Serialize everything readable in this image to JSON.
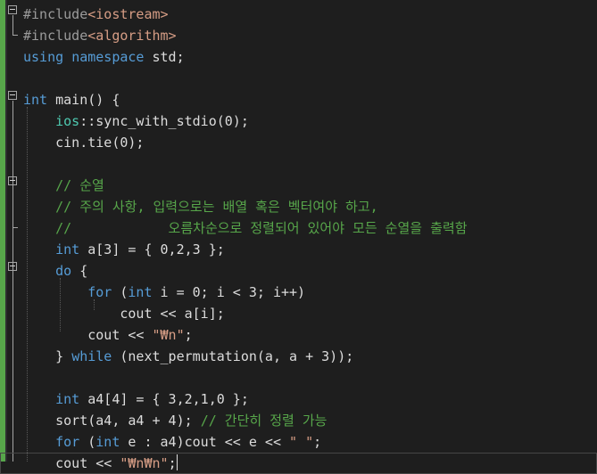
{
  "editor": {
    "lines": [
      {
        "tokens": [
          {
            "t": "#include",
            "c": "pp"
          },
          {
            "t": "<iostream>",
            "c": "inc"
          }
        ]
      },
      {
        "tokens": [
          {
            "t": "#include",
            "c": "pp"
          },
          {
            "t": "<algorithm>",
            "c": "inc"
          }
        ]
      },
      {
        "tokens": [
          {
            "t": "using",
            "c": "kw"
          },
          {
            "t": " "
          },
          {
            "t": "namespace",
            "c": "kw"
          },
          {
            "t": " std;"
          }
        ]
      },
      {
        "tokens": []
      },
      {
        "tokens": [
          {
            "t": "int",
            "c": "kw"
          },
          {
            "t": " main() {"
          }
        ]
      },
      {
        "tokens": [
          {
            "t": "    "
          },
          {
            "t": "ios",
            "c": "ns"
          },
          {
            "t": "::sync_with_stdio(0);"
          }
        ]
      },
      {
        "tokens": [
          {
            "t": "    cin.tie(0);"
          }
        ]
      },
      {
        "tokens": []
      },
      {
        "tokens": [
          {
            "t": "    "
          },
          {
            "t": "// 순열",
            "c": "cm"
          }
        ]
      },
      {
        "tokens": [
          {
            "t": "    "
          },
          {
            "t": "// 주의 사항, 입력으로는 배열 혹은 벡터여야 하고,",
            "c": "cm"
          }
        ]
      },
      {
        "tokens": [
          {
            "t": "    "
          },
          {
            "t": "//            오름차순으로 정렬되어 있어야 모든 순열을 출력함",
            "c": "cm"
          }
        ]
      },
      {
        "tokens": [
          {
            "t": "    "
          },
          {
            "t": "int",
            "c": "kw"
          },
          {
            "t": " a[3] = { 0,2,3 };"
          }
        ]
      },
      {
        "tokens": [
          {
            "t": "    "
          },
          {
            "t": "do",
            "c": "kw"
          },
          {
            "t": " {"
          }
        ]
      },
      {
        "tokens": [
          {
            "t": "        "
          },
          {
            "t": "for",
            "c": "kw"
          },
          {
            "t": " ("
          },
          {
            "t": "int",
            "c": "kw"
          },
          {
            "t": " i = 0; i < 3; i++)"
          }
        ]
      },
      {
        "tokens": [
          {
            "t": "            cout << a[i];"
          }
        ]
      },
      {
        "tokens": [
          {
            "t": "        cout << "
          },
          {
            "t": "\"₩n\"",
            "c": "str"
          },
          {
            "t": ";"
          }
        ]
      },
      {
        "tokens": [
          {
            "t": "    } "
          },
          {
            "t": "while",
            "c": "kw"
          },
          {
            "t": " (next_permutation(a, a + 3));"
          }
        ]
      },
      {
        "tokens": []
      },
      {
        "tokens": [
          {
            "t": "    "
          },
          {
            "t": "int",
            "c": "kw"
          },
          {
            "t": " a4[4] = { 3,2,1,0 };"
          }
        ]
      },
      {
        "tokens": [
          {
            "t": "    sort(a4, a4 + 4); "
          },
          {
            "t": "// 간단히 정렬 가능",
            "c": "cm"
          }
        ]
      },
      {
        "tokens": [
          {
            "t": "    "
          },
          {
            "t": "for",
            "c": "kw"
          },
          {
            "t": " ("
          },
          {
            "t": "int",
            "c": "kw"
          },
          {
            "t": " e : a4)cout << e << "
          },
          {
            "t": "\" \"",
            "c": "str"
          },
          {
            "t": ";"
          }
        ]
      },
      {
        "tokens": [
          {
            "t": "    cout << "
          },
          {
            "t": "\"₩n₩n\"",
            "c": "str"
          },
          {
            "t": ";"
          }
        ]
      }
    ]
  }
}
